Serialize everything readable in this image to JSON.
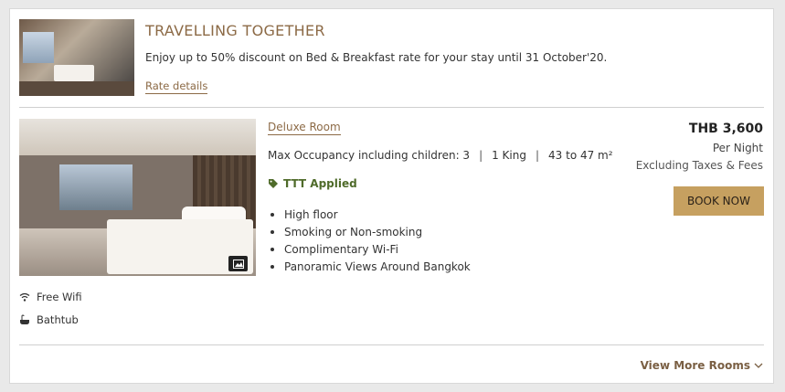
{
  "promo": {
    "image_alt": "hotel room photo",
    "title": "TRAVELLING TOGETHER",
    "description": "Enjoy up to 50% discount on Bed & Breakfast rate for your stay until 31 October'20.",
    "link_label": "Rate details"
  },
  "room": {
    "name": "Deluxe Room",
    "occupancy_label": "Max Occupancy including children: 3",
    "bed": "1 King",
    "size": "43 to 47 m²",
    "separator": "|",
    "offer_badge": "TTT Applied",
    "features": [
      "High floor",
      "Smoking or Non-smoking",
      "Complimentary Wi-Fi",
      "Panoramic Views Around Bangkok"
    ],
    "amenities": [
      {
        "label": "Free Wifi",
        "icon": "wifi-icon"
      },
      {
        "label": "Bathtub",
        "icon": "bathtub-icon"
      }
    ]
  },
  "price": {
    "amount": "THB 3,600",
    "per": "Per Night",
    "tax_note": "Excluding Taxes & Fees"
  },
  "actions": {
    "book_label": "BOOK NOW",
    "view_more_label": "View More Rooms"
  },
  "colors": {
    "accent": "#8c6a46",
    "button": "#c6a060",
    "offer_green": "#4f6b2a"
  }
}
